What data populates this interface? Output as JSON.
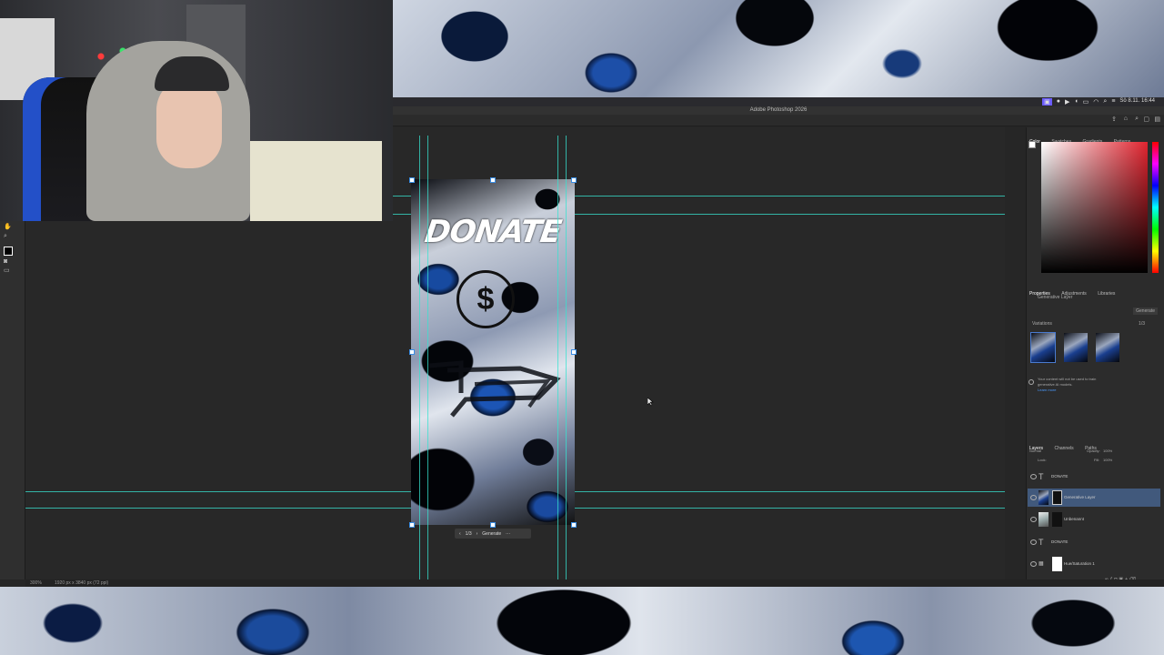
{
  "app": {
    "title": "Adobe Photoshop 2026"
  },
  "menubar": {
    "clock": "Sö 8.11. 16:44",
    "icons": [
      "stream-icon",
      "record-icon",
      "play-icon",
      "volume-icon",
      "battery-icon",
      "wifi-icon",
      "search-icon",
      "control-center-icon"
    ]
  },
  "color_panel": {
    "tabs": [
      "Color",
      "Swatches",
      "Gradients",
      "Patterns"
    ],
    "foreground": "#e0242f"
  },
  "properties_panel": {
    "tabs": [
      "Properties",
      "Adjustments",
      "Libraries"
    ],
    "layer_type": "Generative Layer",
    "generate_label": "Generate",
    "variations_label": "Variations",
    "variations_count": "1/3",
    "notice": "Your content will not be used to train generative AI models.",
    "notice_link": "Learn more"
  },
  "layers_panel": {
    "tabs": [
      "Layers",
      "Channels",
      "Paths"
    ],
    "blend_mode": "Normal",
    "opacity_label": "Opacity:",
    "opacity": "100%",
    "lock_label": "Lock:",
    "fill_label": "Fill:",
    "fill": "100%",
    "layers": [
      {
        "name": "DONATE",
        "kind": "text"
      },
      {
        "name": "Generative Layer",
        "kind": "generative",
        "selected": true
      },
      {
        "name": "Unbenannt",
        "kind": "image"
      },
      {
        "name": "DONATE",
        "kind": "text"
      },
      {
        "name": "Hue/Saturation 1",
        "kind": "adjustment"
      }
    ]
  },
  "canvas": {
    "artboard_text": "DONATE",
    "dollar_symbol": "$"
  },
  "contextual_taskbar": {
    "page": "1/3",
    "generate_label": "Generate",
    "more": "···"
  },
  "statusbar": {
    "zoom": "300%",
    "doc_info": "1920 px x 3840 px (72 ppi)"
  }
}
